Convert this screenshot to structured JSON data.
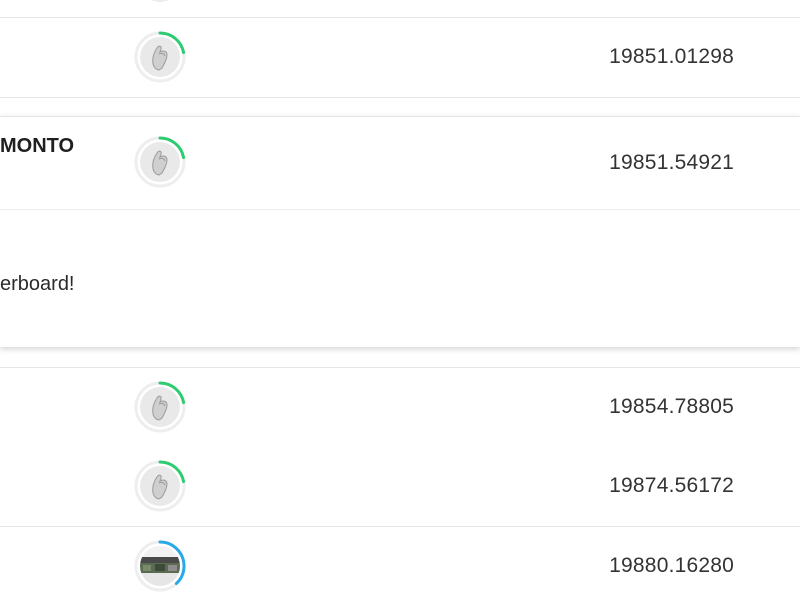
{
  "leaderboard": {
    "rows": [
      {
        "score": "19851.01298",
        "ring_color": "#2ecc71",
        "ring_progress": 0.22,
        "avatar": "hand-avatar-icon"
      },
      {
        "score": "19851.54921",
        "ring_color": "#2ecc71",
        "ring_progress": 0.22,
        "avatar": "hand-avatar-icon",
        "expanded": true
      },
      {
        "score": "19854.78805",
        "ring_color": "#2ecc71",
        "ring_progress": 0.22,
        "avatar": "hand-avatar-icon"
      },
      {
        "score": "19874.56172",
        "ring_color": "#2ecc71",
        "ring_progress": 0.22,
        "avatar": "hand-avatar-icon"
      },
      {
        "score": "19880.16280",
        "ring_color": "#29a9e6",
        "ring_progress": 0.38,
        "avatar": "photo-avatar-icon"
      }
    ],
    "expanded_row": {
      "username": "MONTO",
      "message": "erboard!"
    }
  }
}
